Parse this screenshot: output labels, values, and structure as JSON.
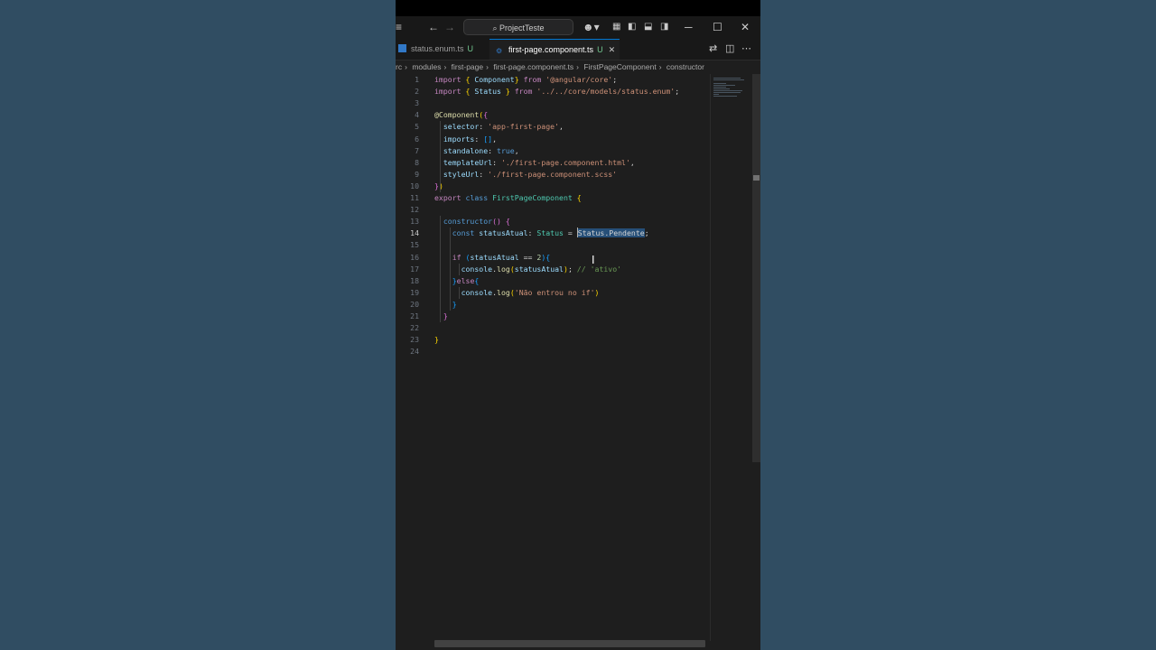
{
  "colors": {
    "accent": "#0078d4",
    "editor_bg": "#1e1e1e",
    "selection": "#264f78",
    "desktop_bg": "#2c4a5f"
  },
  "titlebar": {
    "menu_icon": "hamburger-icon",
    "back_icon": "arrow-left-icon",
    "forward_icon": "arrow-right-icon",
    "search_label": "ProjectTeste",
    "copilot_icon": "copilot-icon",
    "minimize_glyph": "─",
    "maximize_glyph": "☐",
    "close_glyph": "✕"
  },
  "tabs": [
    {
      "label": "status.enum.ts",
      "badge": "U",
      "active": false
    },
    {
      "label": "first-page.component.ts",
      "badge": "U",
      "active": true
    }
  ],
  "tab_close_glyph": "✕",
  "breadcrumb": [
    "rc",
    "modules",
    "first-page",
    "first-page.component.ts",
    "FirstPageComponent",
    "constructor"
  ],
  "editor": {
    "current_line": 14,
    "line_numbers": [
      "1",
      "2",
      "3",
      "4",
      "5",
      "6",
      "7",
      "8",
      "9",
      "10",
      "11",
      "12",
      "13",
      "14",
      "15",
      "16",
      "17",
      "18",
      "19",
      "20",
      "21",
      "22",
      "23",
      "24"
    ],
    "lines": [
      [
        {
          "t": "import ",
          "c": "kw"
        },
        {
          "t": "{ ",
          "c": "br1"
        },
        {
          "t": "Component",
          "c": "prop"
        },
        {
          "t": "} ",
          "c": "br1"
        },
        {
          "t": "from ",
          "c": "kw"
        },
        {
          "t": "'@angular/core'",
          "c": "str"
        },
        {
          "t": ";",
          "c": ""
        }
      ],
      [
        {
          "t": "import ",
          "c": "kw"
        },
        {
          "t": "{ ",
          "c": "br1"
        },
        {
          "t": "Status ",
          "c": "prop"
        },
        {
          "t": "} ",
          "c": "br1"
        },
        {
          "t": "from ",
          "c": "kw"
        },
        {
          "t": "'../../core/models/status.enum'",
          "c": "str"
        },
        {
          "t": ";",
          "c": ""
        }
      ],
      [],
      [
        {
          "t": "@Component",
          "c": "deco"
        },
        {
          "t": "(",
          "c": "br1"
        },
        {
          "t": "{",
          "c": "br2"
        }
      ],
      [
        {
          "t": "  selector",
          "c": "prop"
        },
        {
          "t": ": ",
          "c": ""
        },
        {
          "t": "'app-first-page'",
          "c": "str"
        },
        {
          "t": ",",
          "c": ""
        }
      ],
      [
        {
          "t": "  imports",
          "c": "prop"
        },
        {
          "t": ": ",
          "c": ""
        },
        {
          "t": "[]",
          "c": "br3"
        },
        {
          "t": ",",
          "c": ""
        }
      ],
      [
        {
          "t": "  standalone",
          "c": "prop"
        },
        {
          "t": ": ",
          "c": ""
        },
        {
          "t": "true",
          "c": "kw2"
        },
        {
          "t": ",",
          "c": ""
        }
      ],
      [
        {
          "t": "  templateUrl",
          "c": "prop"
        },
        {
          "t": ": ",
          "c": ""
        },
        {
          "t": "'./first-page.component.html'",
          "c": "str"
        },
        {
          "t": ",",
          "c": ""
        }
      ],
      [
        {
          "t": "  styleUrl",
          "c": "prop"
        },
        {
          "t": ": ",
          "c": ""
        },
        {
          "t": "'./first-page.component.scss'",
          "c": "str"
        }
      ],
      [
        {
          "t": "}",
          "c": "br2"
        },
        {
          "t": ")",
          "c": "br1"
        }
      ],
      [
        {
          "t": "export ",
          "c": "kw"
        },
        {
          "t": "class ",
          "c": "kw2"
        },
        {
          "t": "FirstPageComponent ",
          "c": "cls"
        },
        {
          "t": "{",
          "c": "br1"
        }
      ],
      [],
      [
        {
          "t": "  constructor",
          "c": "kw2"
        },
        {
          "t": "() ",
          "c": "br2"
        },
        {
          "t": "{",
          "c": "br2"
        }
      ],
      [
        {
          "t": "    const ",
          "c": "kw2"
        },
        {
          "t": "statusAtual",
          "c": "prop"
        },
        {
          "t": ": ",
          "c": ""
        },
        {
          "t": "Status ",
          "c": "cls"
        },
        {
          "t": "= ",
          "c": ""
        },
        {
          "t": "|",
          "c": "cursor"
        },
        {
          "t": "Status.Pendente",
          "c": "sel"
        },
        {
          "t": ";",
          "c": ""
        }
      ],
      [],
      [
        {
          "t": "    if ",
          "c": "kw"
        },
        {
          "t": "(",
          "c": "br3"
        },
        {
          "t": "statusAtual ",
          "c": "prop"
        },
        {
          "t": "== ",
          "c": ""
        },
        {
          "t": "2",
          "c": "num"
        },
        {
          "t": ")",
          "c": "br3"
        },
        {
          "t": "{",
          "c": "br3"
        }
      ],
      [
        {
          "t": "      console",
          "c": "prop"
        },
        {
          "t": ".",
          "c": ""
        },
        {
          "t": "log",
          "c": "fn"
        },
        {
          "t": "(",
          "c": "br1"
        },
        {
          "t": "statusAtual",
          "c": "prop"
        },
        {
          "t": ")",
          "c": "br1"
        },
        {
          "t": "; ",
          "c": ""
        },
        {
          "t": "// 'ativo'",
          "c": "cmt"
        }
      ],
      [
        {
          "t": "    }",
          "c": "br3"
        },
        {
          "t": "else",
          "c": "kw"
        },
        {
          "t": "{",
          "c": "br3"
        }
      ],
      [
        {
          "t": "      console",
          "c": "prop"
        },
        {
          "t": ".",
          "c": ""
        },
        {
          "t": "log",
          "c": "fn"
        },
        {
          "t": "(",
          "c": "br1"
        },
        {
          "t": "'Não entrou no if'",
          "c": "str"
        },
        {
          "t": ")",
          "c": "br1"
        }
      ],
      [
        {
          "t": "    }",
          "c": "br3"
        }
      ],
      [
        {
          "t": "  }",
          "c": "br2"
        }
      ],
      [],
      [
        {
          "t": "}",
          "c": "br1"
        }
      ],
      []
    ]
  }
}
